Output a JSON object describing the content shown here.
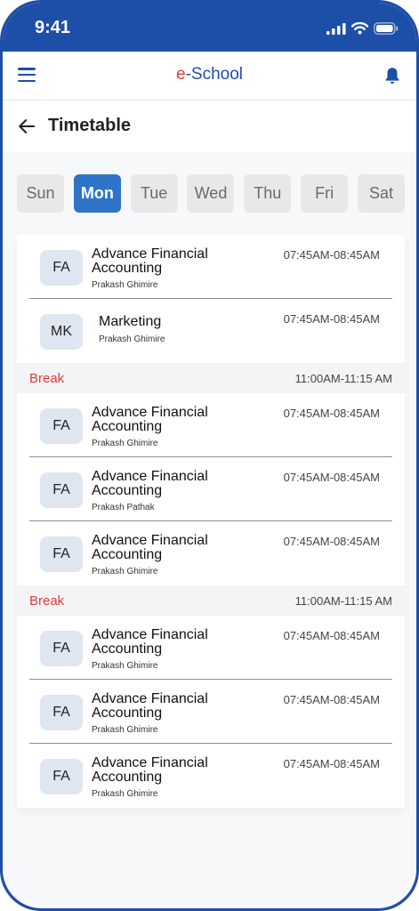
{
  "status_bar": {
    "time": "9:41"
  },
  "app_bar": {
    "brand_prefix": "e",
    "brand_rest": "-School"
  },
  "page": {
    "title": "Timetable"
  },
  "days": [
    {
      "label": "Sun",
      "active": false
    },
    {
      "label": "Mon",
      "active": true
    },
    {
      "label": "Tue",
      "active": false
    },
    {
      "label": "Wed",
      "active": false
    },
    {
      "label": "Thu",
      "active": false
    },
    {
      "label": "Fri",
      "active": false
    },
    {
      "label": "Sat",
      "active": false
    }
  ],
  "schedule": [
    {
      "type": "class",
      "badge": "FA",
      "subject": "Advance Financial Accounting",
      "teacher": "Prakash Ghimire",
      "time": "07:45AM-08:45AM"
    },
    {
      "type": "class",
      "badge": "MK",
      "subject": "Marketing",
      "teacher": "Prakash Ghimire",
      "time": "07:45AM-08:45AM"
    },
    {
      "type": "break",
      "label": "Break",
      "time": "11:00AM-11:15 AM"
    },
    {
      "type": "class",
      "badge": "FA",
      "subject": "Advance Financial Accounting",
      "teacher": "Prakash Ghimire",
      "time": "07:45AM-08:45AM"
    },
    {
      "type": "class",
      "badge": "FA",
      "subject": "Advance Financial Accounting",
      "teacher": "Prakash Pathak",
      "time": "07:45AM-08:45AM"
    },
    {
      "type": "class",
      "badge": "FA",
      "subject": "Advance Financial Accounting",
      "teacher": "Prakash Ghimire",
      "time": "07:45AM-08:45AM"
    },
    {
      "type": "break",
      "label": "Break",
      "time": "11:00AM-11:15 AM"
    },
    {
      "type": "class",
      "badge": "FA",
      "subject": "Advance Financial Accounting",
      "teacher": "Prakash Ghimire",
      "time": "07:45AM-08:45AM"
    },
    {
      "type": "class",
      "badge": "FA",
      "subject": "Advance Financial Accounting",
      "teacher": "Prakash Ghimire",
      "time": "07:45AM-08:45AM"
    },
    {
      "type": "class",
      "badge": "FA",
      "subject": "Advance Financial Accounting",
      "teacher": "Prakash Ghimire",
      "time": "07:45AM-08:45AM"
    }
  ],
  "colors": {
    "primary": "#1e4fa8",
    "active_day": "#2f73c9",
    "break_red": "#e53935",
    "badge_bg": "#dfe6f1"
  },
  "icons": {
    "menu": "hamburger-menu-icon",
    "notifications": "bell-icon",
    "back": "arrow-left-icon",
    "signal": "signal-icon",
    "wifi": "wifi-icon",
    "battery": "battery-icon"
  }
}
